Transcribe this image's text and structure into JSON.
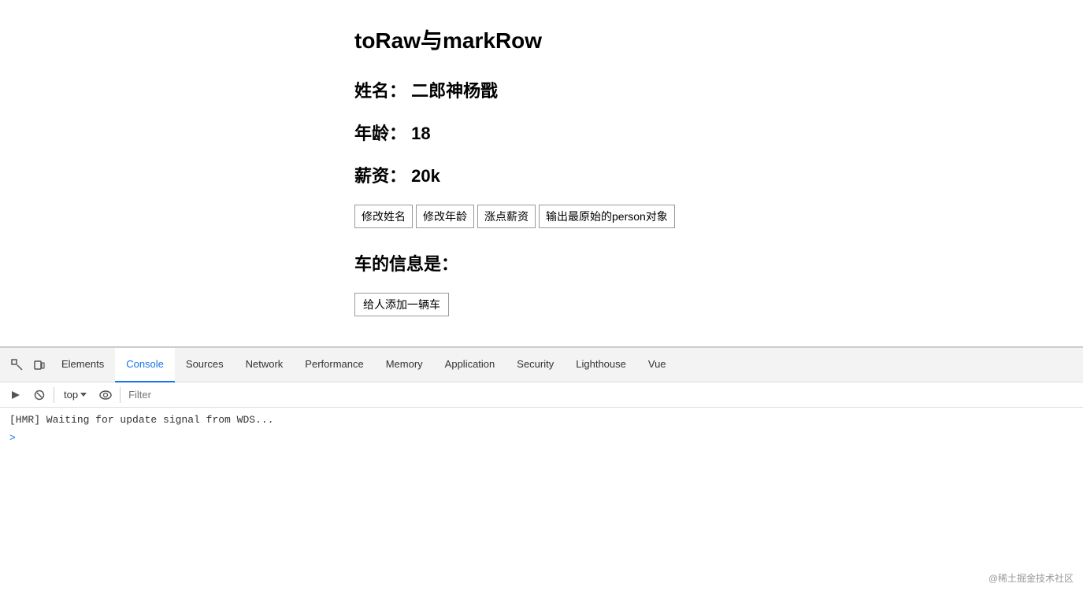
{
  "main": {
    "title": "toRaw与markRow",
    "name_label": "姓名：",
    "name_value": "二郎神杨戬",
    "age_label": "年龄：",
    "age_value": "18",
    "salary_label": "薪资：",
    "salary_value": "20k",
    "buttons": [
      {
        "id": "btn-change-name",
        "label": "修改姓名"
      },
      {
        "id": "btn-change-age",
        "label": "修改年龄"
      },
      {
        "id": "btn-raise-salary",
        "label": "涨点薪资"
      },
      {
        "id": "btn-output-raw",
        "label": "输出最原始的person对象"
      }
    ],
    "car_section_title": "车的信息是：",
    "add_car_btn": "给人添加一辆车"
  },
  "devtools": {
    "tabs": [
      {
        "id": "tab-elements",
        "label": "Elements",
        "active": false
      },
      {
        "id": "tab-console",
        "label": "Console",
        "active": true
      },
      {
        "id": "tab-sources",
        "label": "Sources",
        "active": false
      },
      {
        "id": "tab-network",
        "label": "Network",
        "active": false
      },
      {
        "id": "tab-performance",
        "label": "Performance",
        "active": false
      },
      {
        "id": "tab-memory",
        "label": "Memory",
        "active": false
      },
      {
        "id": "tab-application",
        "label": "Application",
        "active": false
      },
      {
        "id": "tab-security",
        "label": "Security",
        "active": false
      },
      {
        "id": "tab-lighthouse",
        "label": "Lighthouse",
        "active": false
      },
      {
        "id": "tab-vue",
        "label": "Vue",
        "active": false
      }
    ],
    "toolbar": {
      "top_label": "top",
      "filter_placeholder": "Filter"
    },
    "console_output": [
      {
        "type": "hmr",
        "text": "[HMR] Waiting for update signal from WDS..."
      },
      {
        "type": "prompt",
        "text": ">"
      }
    ]
  },
  "watermark": "@稀土掘金技术社区"
}
